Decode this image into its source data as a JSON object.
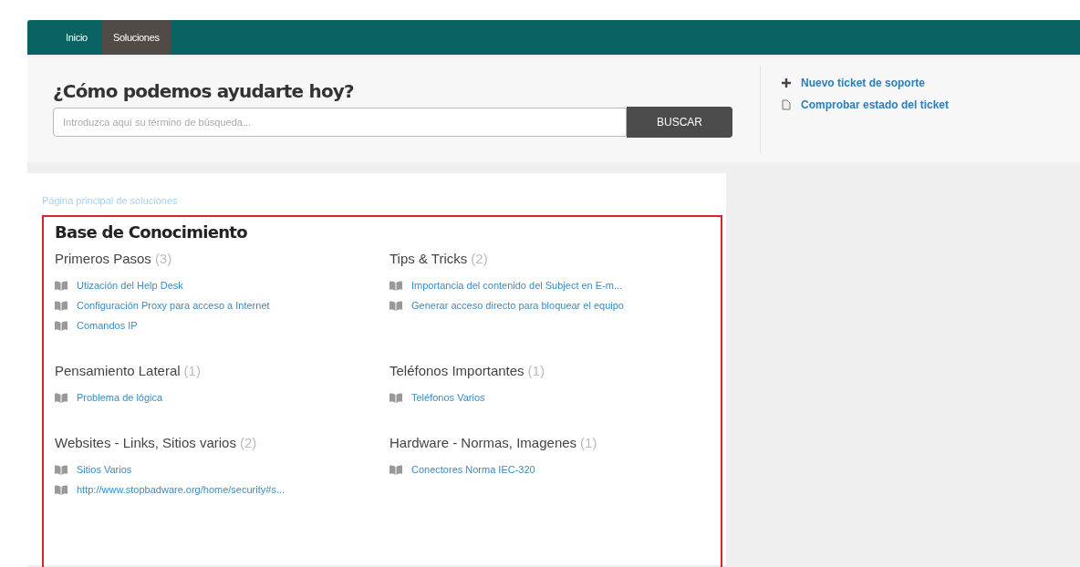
{
  "nav": {
    "tabs": [
      {
        "label": "Inicio",
        "selected": false
      },
      {
        "label": "Soluciones",
        "selected": true
      }
    ]
  },
  "help": {
    "title": "¿Cómo podemos ayudarte hoy?",
    "search": {
      "placeholder": "Introduzca aquí su término de búsqueda..."
    },
    "button": "BUSCAR"
  },
  "actions": [
    {
      "kind": "plus",
      "label": "Nuevo ticket de soporte"
    },
    {
      "kind": "document",
      "label": "Comprobar estado del ticket"
    }
  ],
  "breadcrumb": "Página principal de soluciones",
  "knowledge_base": {
    "title": "Base de Conocimiento",
    "categories": [
      {
        "name": "Primeros Pasos",
        "count": "(3)",
        "articles": [
          "Utización del Help Desk",
          "Configuración Proxy para acceso a Internet",
          "Comandos IP"
        ]
      },
      {
        "name": "Tips & Tricks",
        "count": "(2)",
        "articles": [
          "Importancia del contenido del Subject en E-m...",
          "Generar acceso directo para bloquear el equipo"
        ]
      },
      {
        "name": "Pensamiento Lateral",
        "count": "(1)",
        "articles": [
          "Problema de lógica"
        ]
      },
      {
        "name": "Teléfonos Importantes",
        "count": "(1)",
        "articles": [
          "Teléfonos Varios"
        ]
      },
      {
        "name": "Websites - Links, Sitios varios",
        "count": "(2)",
        "articles": [
          "Sitios Varios",
          "http://www.stopbadware.org/home/security#s..."
        ]
      },
      {
        "name": "Hardware - Normas, Imagenes",
        "count": "(1)",
        "articles": [
          "Conectores Norma IEC-320"
        ]
      }
    ]
  }
}
